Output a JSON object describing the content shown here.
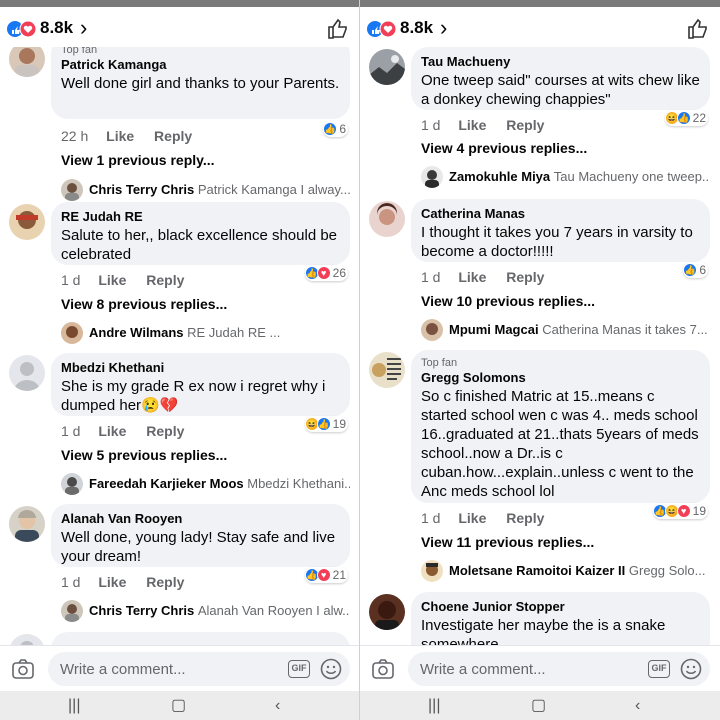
{
  "header": {
    "reaction_count": "8.8k"
  },
  "composer": {
    "placeholder": "Write a comment...",
    "gif_label": "GIF"
  },
  "left": {
    "comments": [
      {
        "badge": "Top fan",
        "name": "Patrick Kamanga",
        "text": "Well done girl and thanks to your Parents.",
        "time": "22 h",
        "like": "Like",
        "reply": "Reply",
        "react_count": "6",
        "view_previous": "View 1 previous reply...",
        "reply_name": "Chris Terry Chris",
        "reply_text": "Patrick Kamanga  I alway..."
      },
      {
        "name": "RE Judah RE",
        "text": "Salute to her,, black excellence should be celebrated",
        "time": "1 d",
        "like": "Like",
        "reply": "Reply",
        "react_count": "26",
        "view_previous": "View 8 previous replies...",
        "reply_name": "Andre Wilmans",
        "reply_text": "RE Judah RE ..."
      },
      {
        "name": "Mbedzi Khethani",
        "text": "She is my grade R ex now i regret why i dumped her😢💔",
        "time": "1 d",
        "like": "Like",
        "reply": "Reply",
        "react_count": "19",
        "view_previous": "View 5 previous replies...",
        "reply_name": "Fareedah Karjieker Moos",
        "reply_text": "Mbedzi Khethani..."
      },
      {
        "name": "Alanah Van Rooyen",
        "text": "Well done, young lady! Stay safe and live your dream!",
        "time": "1 d",
        "like": "Like",
        "reply": "Reply",
        "react_count": "21",
        "reply_name": "Chris Terry Chris",
        "reply_text": "Alanah Van Rooyen  I alw..."
      }
    ]
  },
  "right": {
    "comments": [
      {
        "name": "Tau Machueny",
        "text": "One tweep said\" courses at wits chew like a donkey chewing chappies\"",
        "time": "1 d",
        "like": "Like",
        "reply": "Reply",
        "react_count": "22",
        "view_previous": "View 4 previous replies...",
        "reply_name": "Zamokuhle Miya",
        "reply_text": "Tau Machueny one tweep..."
      },
      {
        "name": "Catherina Manas",
        "text": "I thought it takes you 7 years in varsity to become a doctor!!!!!",
        "time": "1 d",
        "like": "Like",
        "reply": "Reply",
        "react_count": "6",
        "view_previous": "View 10 previous replies...",
        "reply_name": "Mpumi Magcai",
        "reply_text": "Catherina Manas it takes 7..."
      },
      {
        "badge": "Top fan",
        "name": "Gregg Solomons",
        "text": "So c finished Matric at 15..means c started school wen c was 4.. meds school 16..graduated at 21..thats 5years of meds school..now a Dr..is c cuban.how...explain..unless c went to the Anc meds school lol",
        "time": "1 d",
        "like": "Like",
        "reply": "Reply",
        "react_count": "19",
        "view_previous": "View 11 previous replies...",
        "reply_name": "Moletsane Ramoitoi Kaizer II",
        "reply_text": "Gregg Solo..."
      },
      {
        "name": "Choene Junior Stopper",
        "text": "Investigate her maybe the is a snake somewhere"
      }
    ]
  }
}
